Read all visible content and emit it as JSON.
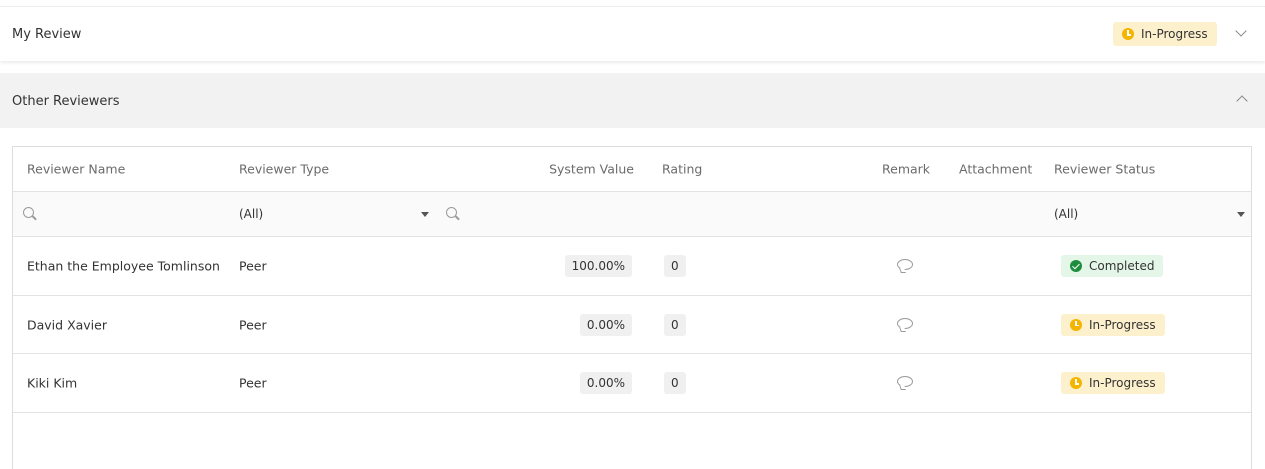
{
  "my_review": {
    "title": "My Review",
    "status": {
      "label": "In-Progress",
      "icon": "clock-icon",
      "color": "#f4b400"
    }
  },
  "other_reviewers": {
    "title": "Other Reviewers",
    "columns": {
      "name": "Reviewer Name",
      "type": "Reviewer Type",
      "system_value": "System Value",
      "rating": "Rating",
      "remark": "Remark",
      "attachment": "Attachment",
      "status": "Reviewer Status"
    },
    "filters": {
      "type": "(All)",
      "status": "(All)"
    },
    "rows": [
      {
        "name": "Ethan the Employee Tomlinson",
        "type": "Peer",
        "system_value": "100.00%",
        "rating": "0",
        "status": "Completed"
      },
      {
        "name": "David Xavier",
        "type": "Peer",
        "system_value": "0.00%",
        "rating": "0",
        "status": "In-Progress"
      },
      {
        "name": "Kiki Kim",
        "type": "Peer",
        "system_value": "0.00%",
        "rating": "0",
        "status": "In-Progress"
      }
    ]
  },
  "colors": {
    "in_progress_bg": "#fdf0cc",
    "in_progress_icon": "#f4b400",
    "completed_bg": "#e4f6e7",
    "completed_icon": "#1e8e3e"
  }
}
